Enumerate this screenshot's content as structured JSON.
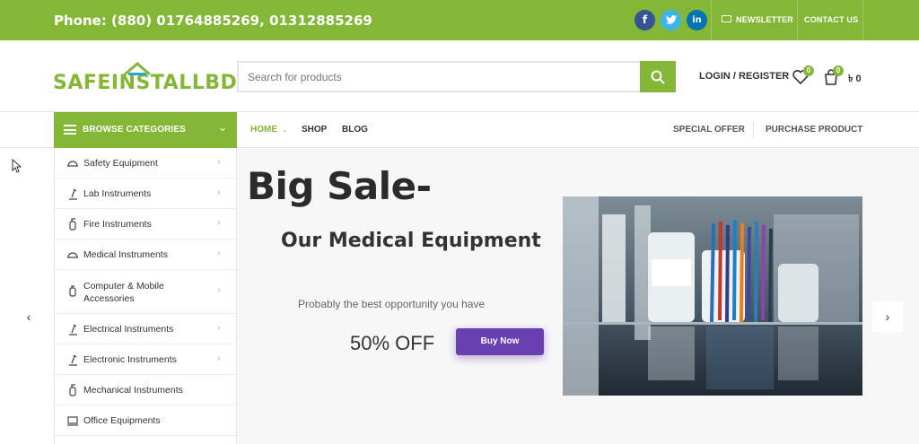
{
  "topbar": {
    "phone": "Phone: (880) 01764885269, 01312885269",
    "social": [
      "f",
      "t",
      "in"
    ],
    "newsletter": "NEWSLETTER",
    "contact": "CONTACT US"
  },
  "header": {
    "logo": "SAFEINSTALLBD",
    "search_placeholder": "Search for products",
    "login": "LOGIN / REGISTER",
    "wishlist_count": "0",
    "cart_count": "0",
    "cart_total": "৳ 0"
  },
  "nav": {
    "browse": "BROWSE CATEGORIES",
    "links": [
      "HOME",
      "SHOP",
      "BLOG"
    ],
    "right_links": [
      "SPECIAL OFFER",
      "PURCHASE PRODUCT"
    ]
  },
  "categories": [
    "Safety Equipment",
    "Lab Instruments",
    "Fire Instruments",
    "Medical Instruments",
    "Computer & Mobile Accessories",
    "Electrical Instruments",
    "Electronic Instruments",
    "Mechanical Instruments",
    "Office Equipments"
  ],
  "slider": {
    "headline": "Big Sale-",
    "subheadline": "Our Medical Equipment",
    "description": "Probably the best opportunity you have",
    "offer": "50% OFF",
    "button": "Buy Now"
  },
  "colors": {
    "brand": "#83b735",
    "button": "#6a3fb0",
    "facebook": "#365493",
    "twitter": "#3cb4f1",
    "linkedin": "#0274b3"
  }
}
